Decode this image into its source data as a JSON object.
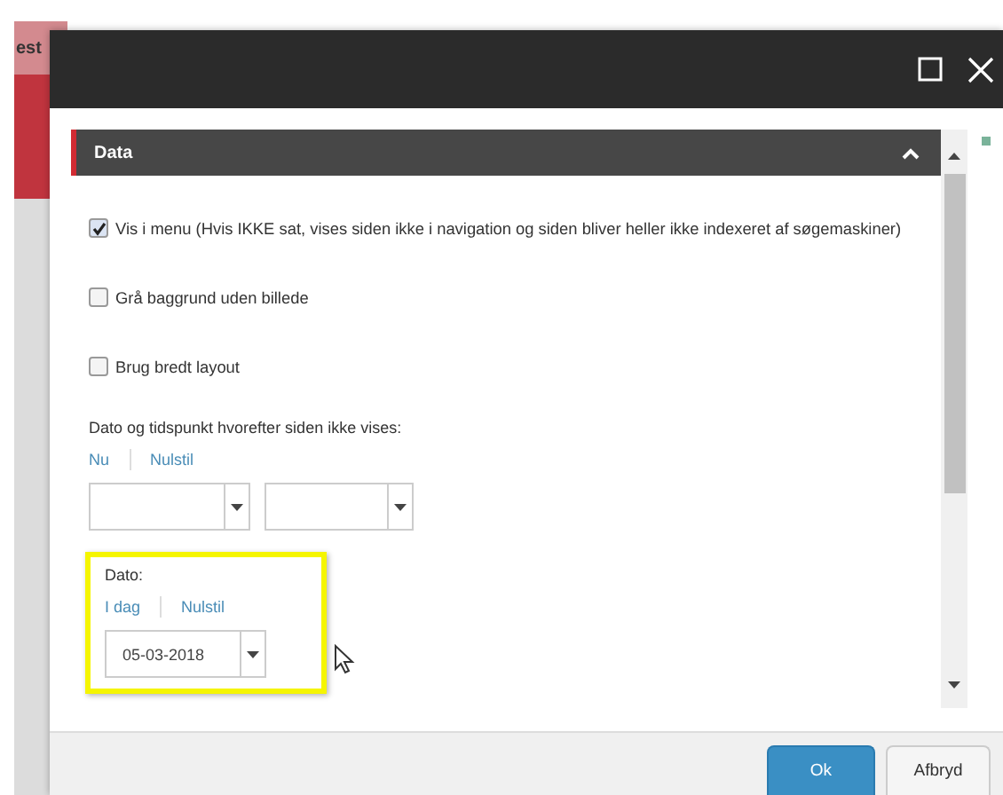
{
  "background": {
    "tab": "est"
  },
  "dialog": {
    "section": {
      "title": "Data",
      "expanded": true
    },
    "checkboxes": [
      {
        "label": "Vis i menu (Hvis IKKE sat, vises siden ikke i navigation og siden bliver heller ikke indexeret af søgemaskiner)",
        "checked": true
      },
      {
        "label": "Grå baggrund uden billede",
        "checked": false
      },
      {
        "label": "Brug bredt layout",
        "checked": false
      }
    ],
    "expiry": {
      "label": "Dato og tidspunkt hvorefter siden ikke vises:",
      "links": [
        "Nu",
        "Nulstil"
      ]
    },
    "date": {
      "label": "Dato:",
      "links": [
        "I dag",
        "Nulstil"
      ],
      "value": "05-03-2018",
      "highlighted": true
    },
    "buttons": [
      {
        "label": "Ok",
        "kind": "primary"
      },
      {
        "label": "Afbryd",
        "kind": "secondary"
      }
    ]
  }
}
